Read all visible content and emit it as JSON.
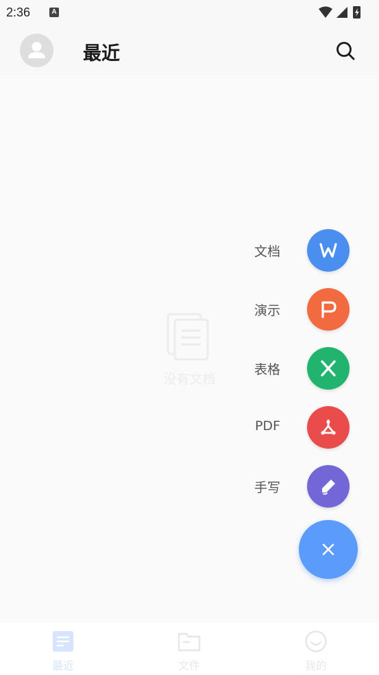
{
  "status_bar": {
    "time": "2:36",
    "notification_glyph": "A"
  },
  "header": {
    "title": "最近"
  },
  "empty_state": {
    "text": "没有文档"
  },
  "fab_menu": {
    "items": [
      {
        "label": "文档",
        "color": "#4a8ef0",
        "icon": "word-doc-icon"
      },
      {
        "label": "演示",
        "color": "#f26b40",
        "icon": "presentation-icon"
      },
      {
        "label": "表格",
        "color": "#21b46e",
        "icon": "spreadsheet-icon"
      },
      {
        "label": "PDF",
        "color": "#ea4c4c",
        "icon": "pdf-icon"
      },
      {
        "label": "手写",
        "color": "#7367d8",
        "icon": "handwriting-pen-icon"
      }
    ],
    "close_color": "#5a9bfb"
  },
  "bottom_nav": {
    "items": [
      {
        "label": "最近",
        "icon": "recent-docs-icon",
        "active": true
      },
      {
        "label": "文件",
        "icon": "folder-icon",
        "active": false
      },
      {
        "label": "我的",
        "icon": "profile-smile-icon",
        "active": false
      }
    ],
    "active_color": "#d6e5fd",
    "inactive_color": "#e8e8e8"
  }
}
